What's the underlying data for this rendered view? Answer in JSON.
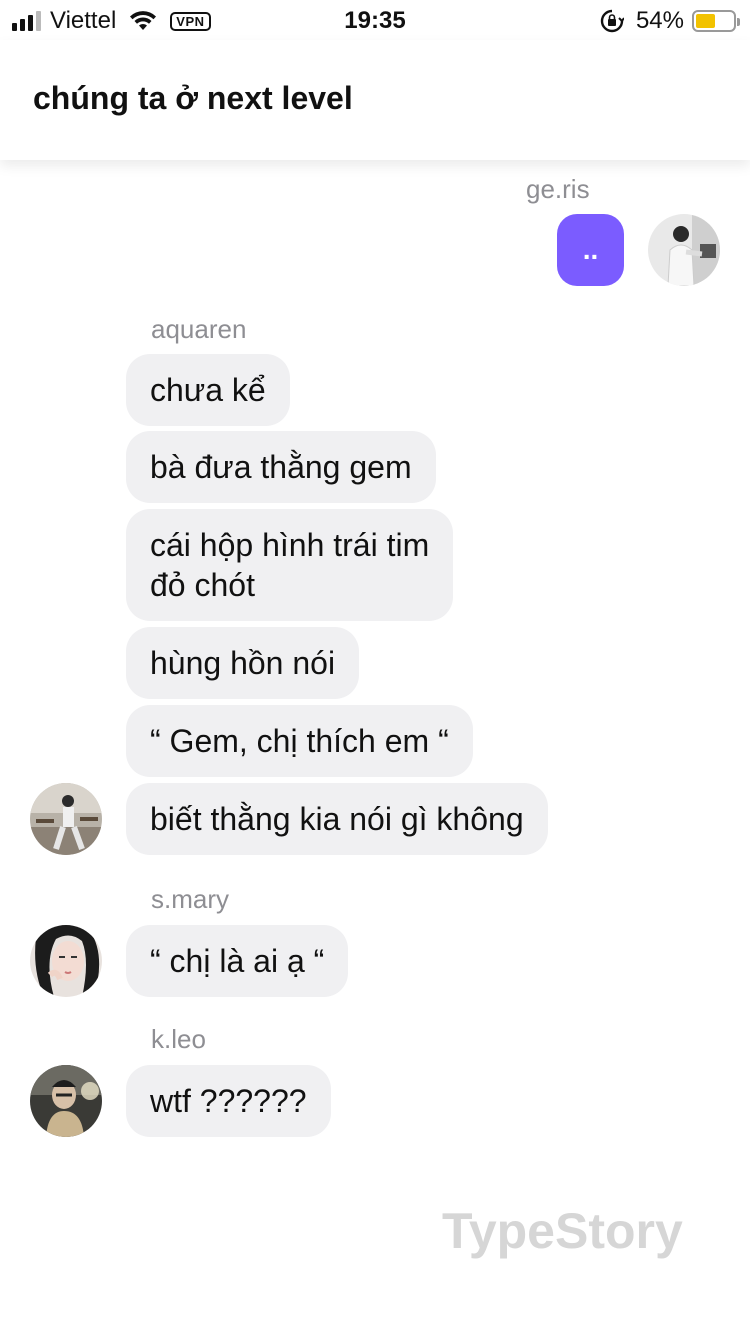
{
  "status_bar": {
    "carrier": "Viettel",
    "vpn": "VPN",
    "time": "19:35",
    "battery_percent": "54%",
    "battery_level": 0.54,
    "battery_color": "#f2c200"
  },
  "header": {
    "title": "chúng ta ở next level"
  },
  "messages": {
    "geris": {
      "sender": "ge.ris",
      "text": "..",
      "bubble_color": "#7b5cff"
    },
    "aquaren": {
      "sender": "aquaren",
      "texts": [
        "chưa kể",
        "bà đưa thằng gem",
        "cái hộp hình trái tim\nđỏ chót",
        "hùng hồn nói",
        "“ Gem, chị thích em “",
        "biết thằng kia nói gì không"
      ]
    },
    "smary": {
      "sender": "s.mary",
      "text": "“ chị là ai ạ “"
    },
    "kleo": {
      "sender": "k.leo",
      "text": "wtf ??????"
    }
  },
  "watermark": "TypeStory",
  "icons": {
    "signal": "signal-icon",
    "wifi": "wifi-icon",
    "rotation_lock": "rotation-lock-icon",
    "battery": "battery-icon"
  }
}
